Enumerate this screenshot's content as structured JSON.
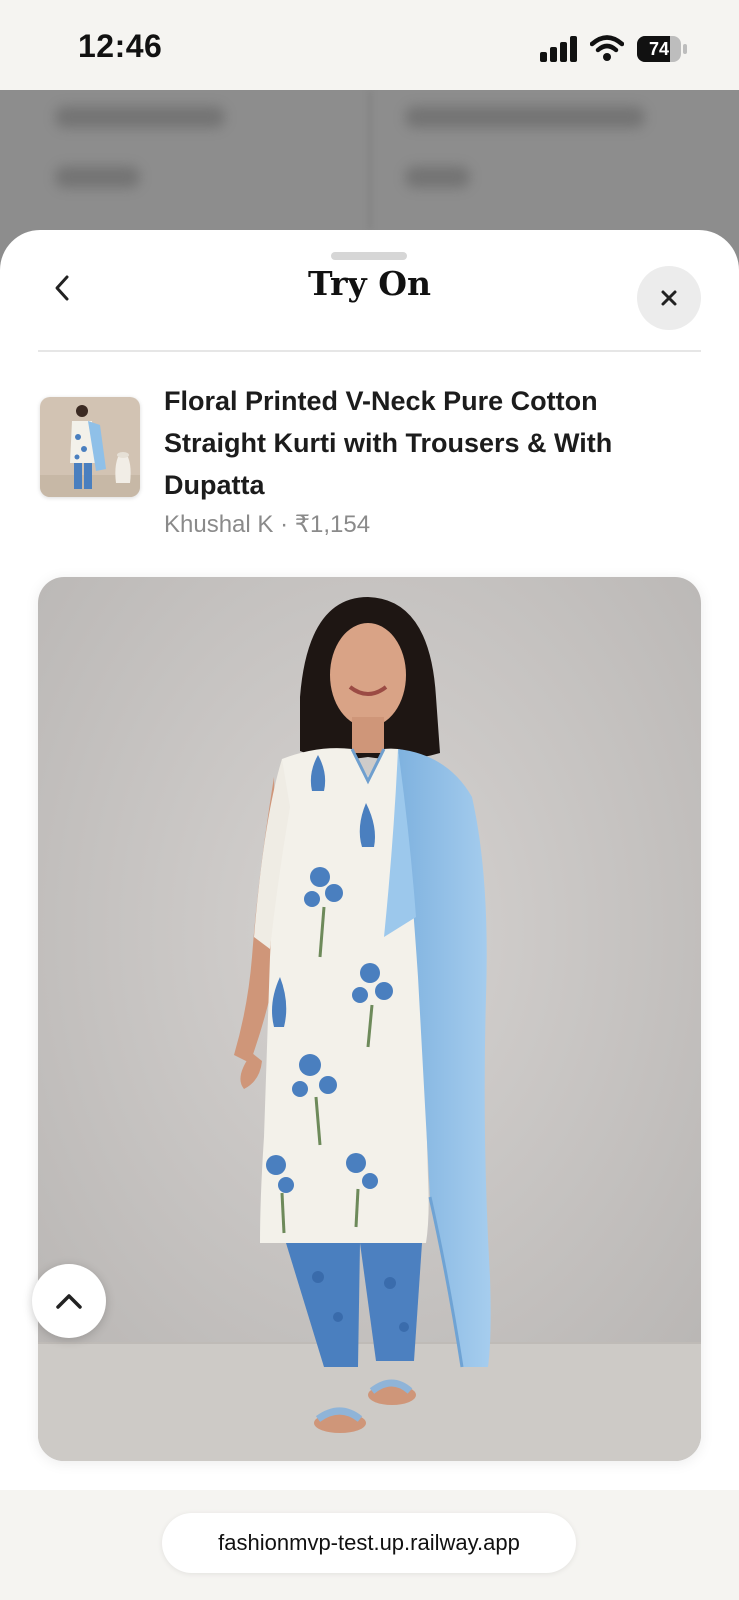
{
  "status_bar": {
    "time": "12:46",
    "battery_level": "74",
    "battery_fraction": 0.74,
    "icons": [
      "cellular-signal-icon",
      "wifi-icon",
      "battery-icon"
    ]
  },
  "sheet": {
    "title": "Try On",
    "back_icon": "chevron-left-icon",
    "close_icon": "close-icon"
  },
  "product": {
    "title": "Floral Printed V-Neck Pure Cotton Straight Kurti with Trousers & With Dupatta",
    "brand": "Khushal K",
    "separator": "·",
    "price": "₹1,154"
  },
  "tryon": {
    "scroll_top_icon": "chevron-up-icon"
  },
  "browser": {
    "url": "fashionmvp-test.up.railway.app"
  },
  "colors": {
    "kurta_white": "#f3f1ea",
    "print_blue": "#4a7fbf",
    "dupatta_blue": "#8fc0e8",
    "leaf_green": "#6d8a5a",
    "background_grey": "#cfcccb"
  }
}
